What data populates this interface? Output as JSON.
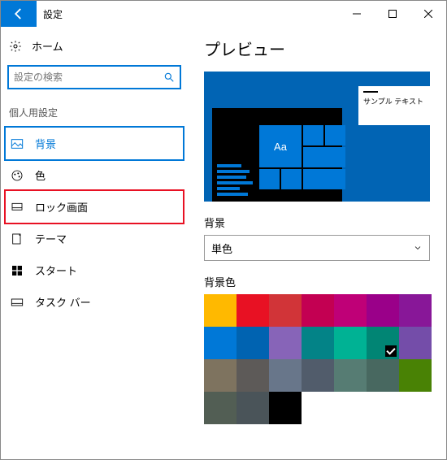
{
  "titlebar": {
    "title": "設定"
  },
  "sidebar": {
    "home_label": "ホーム",
    "search_placeholder": "設定の検索",
    "section_label": "個人用設定",
    "items": [
      {
        "label": "背景"
      },
      {
        "label": "色"
      },
      {
        "label": "ロック画面"
      },
      {
        "label": "テーマ"
      },
      {
        "label": "スタート"
      },
      {
        "label": "タスク バー"
      }
    ]
  },
  "content": {
    "preview_heading": "プレビュー",
    "preview_tile_text": "Aa",
    "preview_note_text": "サンプル テキスト",
    "background_label": "背景",
    "background_dropdown_value": "単色",
    "background_color_label": "背景色",
    "swatches": [
      {
        "hex": "#ffb900",
        "selected": false
      },
      {
        "hex": "#e81123",
        "selected": false
      },
      {
        "hex": "#d13438",
        "selected": false
      },
      {
        "hex": "#c30052",
        "selected": false
      },
      {
        "hex": "#bf0077",
        "selected": false
      },
      {
        "hex": "#9a0089",
        "selected": false
      },
      {
        "hex": "#881798",
        "selected": false
      },
      {
        "hex": "#0078d7",
        "selected": false
      },
      {
        "hex": "#0063b1",
        "selected": false
      },
      {
        "hex": "#8764b8",
        "selected": false
      },
      {
        "hex": "#038387",
        "selected": false
      },
      {
        "hex": "#00b294",
        "selected": false
      },
      {
        "hex": "#018574",
        "selected": true
      },
      {
        "hex": "#persian",
        "selected": false
      },
      {
        "hex": "#7e735f",
        "selected": false
      },
      {
        "hex": "#5d5a58",
        "selected": false
      },
      {
        "hex": "#68768a",
        "selected": false
      },
      {
        "hex": "#515c6b",
        "selected": false
      },
      {
        "hex": "#567c73",
        "selected": false
      },
      {
        "hex": "#486860",
        "selected": false
      },
      {
        "hex": "#498205",
        "selected": false
      },
      {
        "hex": "#525e54",
        "selected": false
      },
      {
        "hex": "#4a5459",
        "selected": false
      },
      {
        "hex": "#000000",
        "selected": false
      }
    ],
    "swatch_colors_row1": [
      "#ffb900",
      "#e81123",
      "#d13438",
      "#c30052",
      "#bf0077",
      "#9a0089",
      "#881798"
    ],
    "swatch_colors_row2": [
      "#0078d7",
      "#0063b1",
      "#8764b8",
      "#038387",
      "#00b294",
      "#018574",
      "#744da9"
    ],
    "swatch_colors_row3": [
      "#7e735f",
      "#5d5a58",
      "#68768a",
      "#515c6b",
      "#567c73",
      "#486860",
      "#498205"
    ],
    "swatch_colors_row4": [
      "#525e54",
      "#4a5459",
      "#000000"
    ],
    "selected_swatch_index": 12
  }
}
